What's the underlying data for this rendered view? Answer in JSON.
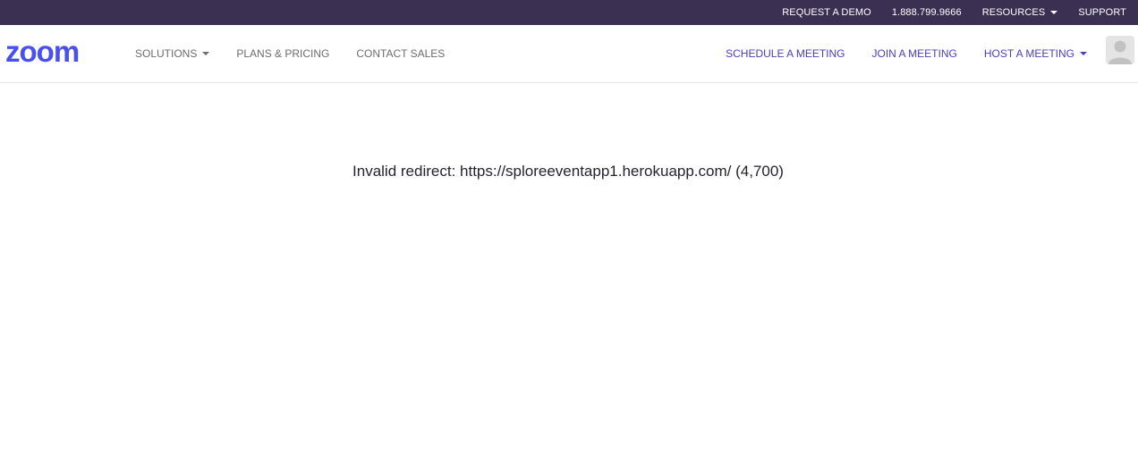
{
  "topbar": {
    "request_demo": "REQUEST A DEMO",
    "phone": "1.888.799.9666",
    "resources": "RESOURCES",
    "support": "SUPPORT"
  },
  "navbar": {
    "logo_text": "zoom",
    "solutions": "SOLUTIONS",
    "plans_pricing": "PLANS & PRICING",
    "contact_sales": "CONTACT SALES",
    "schedule_meeting": "SCHEDULE A MEETING",
    "join_meeting": "JOIN A MEETING",
    "host_meeting": "HOST A MEETING"
  },
  "main": {
    "error_message": "Invalid redirect: https://sploreeventapp1.herokuapp.com/ (4,700)"
  },
  "colors": {
    "topbar_bg": "#3b2f52",
    "brand_blue": "#4a4ff0",
    "nav_accent": "#4b3eb8"
  },
  "icons": {
    "logo": "zoom-logo",
    "caret": "chevron-down-icon",
    "avatar": "user-avatar-icon"
  }
}
